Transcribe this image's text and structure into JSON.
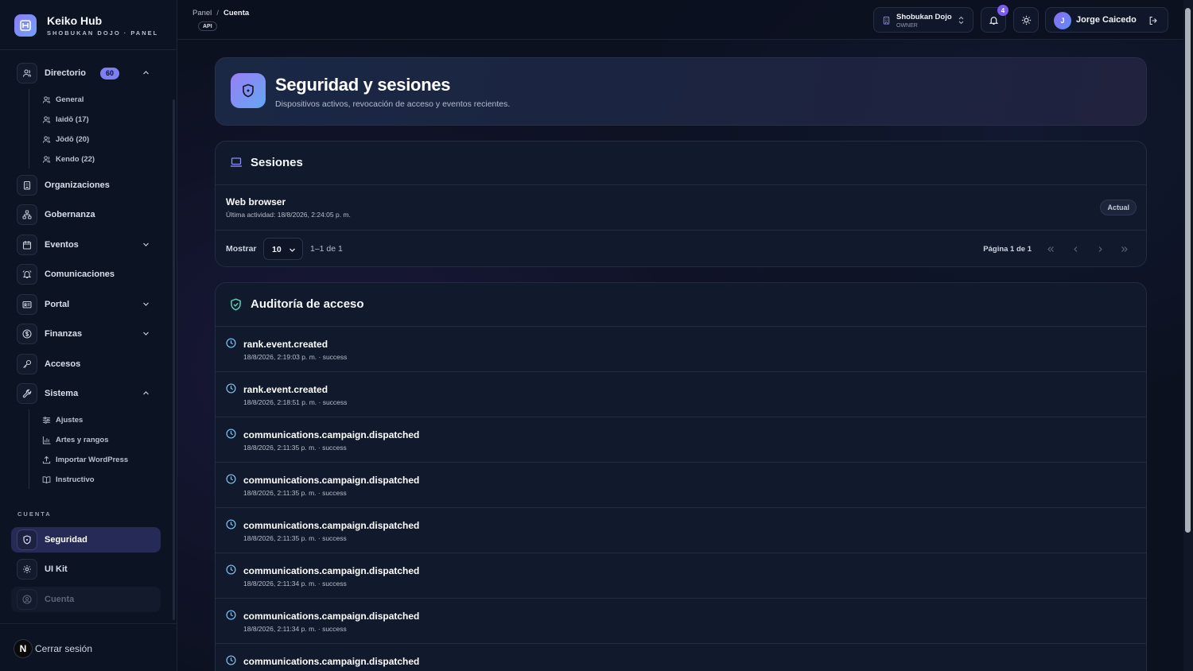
{
  "brand": {
    "title": "Keiko Hub",
    "subtitle": "SHOBUKAN DOJO · PANEL"
  },
  "sidebar": {
    "directorio": {
      "label": "Directorio",
      "badge": "60"
    },
    "directorio_sub": [
      "General",
      "Iaidō (17)",
      "Jōdō (20)",
      "Kendo (22)"
    ],
    "items": {
      "organizaciones": "Organizaciones",
      "gobernanza": "Gobernanza",
      "eventos": "Eventos",
      "comunicaciones": "Comunicaciones",
      "portal": "Portal",
      "finanzas": "Finanzas",
      "accesos": "Accesos",
      "sistema": "Sistema"
    },
    "sistema_sub": [
      "Ajustes",
      "Artes y rangos",
      "Importar WordPress",
      "Instructivo"
    ],
    "section_cuenta": "CUENTA",
    "account": {
      "seguridad": "Seguridad",
      "uikit": "UI Kit",
      "cuenta": "Cuenta"
    },
    "logout": {
      "avatar": "N",
      "label": "Cerrar sesión"
    }
  },
  "topbar": {
    "breadcrumb": [
      "Panel",
      "Cuenta"
    ],
    "breadcrumb_sep": "/",
    "api_badge": "API",
    "org": {
      "name": "Shobukan Dojo",
      "role": "OWNER"
    },
    "notifications_count": "4",
    "user": {
      "initial": "J",
      "name": "Jorge Caicedo"
    }
  },
  "hero": {
    "title": "Seguridad y sesiones",
    "description": "Dispositivos activos, revocación de acceso y eventos recientes."
  },
  "sessions": {
    "title": "Sesiones",
    "rows": [
      {
        "name": "Web browser",
        "last_activity": "Última actividad: 18/8/2026, 2:24:05 p. m.",
        "badge": "Actual"
      }
    ],
    "pager": {
      "show_label": "Mostrar",
      "page_size": "10",
      "range": "1–1 de 1",
      "page": "Página 1 de 1"
    }
  },
  "audit": {
    "title": "Auditoría de acceso",
    "rows": [
      {
        "event": "rank.event.created",
        "meta": "18/8/2026, 2:19:03 p. m. · success"
      },
      {
        "event": "rank.event.created",
        "meta": "18/8/2026, 2:18:51 p. m. · success"
      },
      {
        "event": "communications.campaign.dispatched",
        "meta": "18/8/2026, 2:11:35 p. m. · success"
      },
      {
        "event": "communications.campaign.dispatched",
        "meta": "18/8/2026, 2:11:35 p. m. · success"
      },
      {
        "event": "communications.campaign.dispatched",
        "meta": "18/8/2026, 2:11:35 p. m. · success"
      },
      {
        "event": "communications.campaign.dispatched",
        "meta": "18/8/2026, 2:11:34 p. m. · success"
      },
      {
        "event": "communications.campaign.dispatched",
        "meta": "18/8/2026, 2:11:34 p. m. · success"
      },
      {
        "event": "communications.campaign.dispatched",
        "meta": ""
      }
    ]
  },
  "colors": {
    "accent": "#7f7ff5",
    "active_nav": "#262a57",
    "background": "#0c1120",
    "success_icon": "#5ad6b4",
    "clock_icon": "#7ec3f2"
  }
}
